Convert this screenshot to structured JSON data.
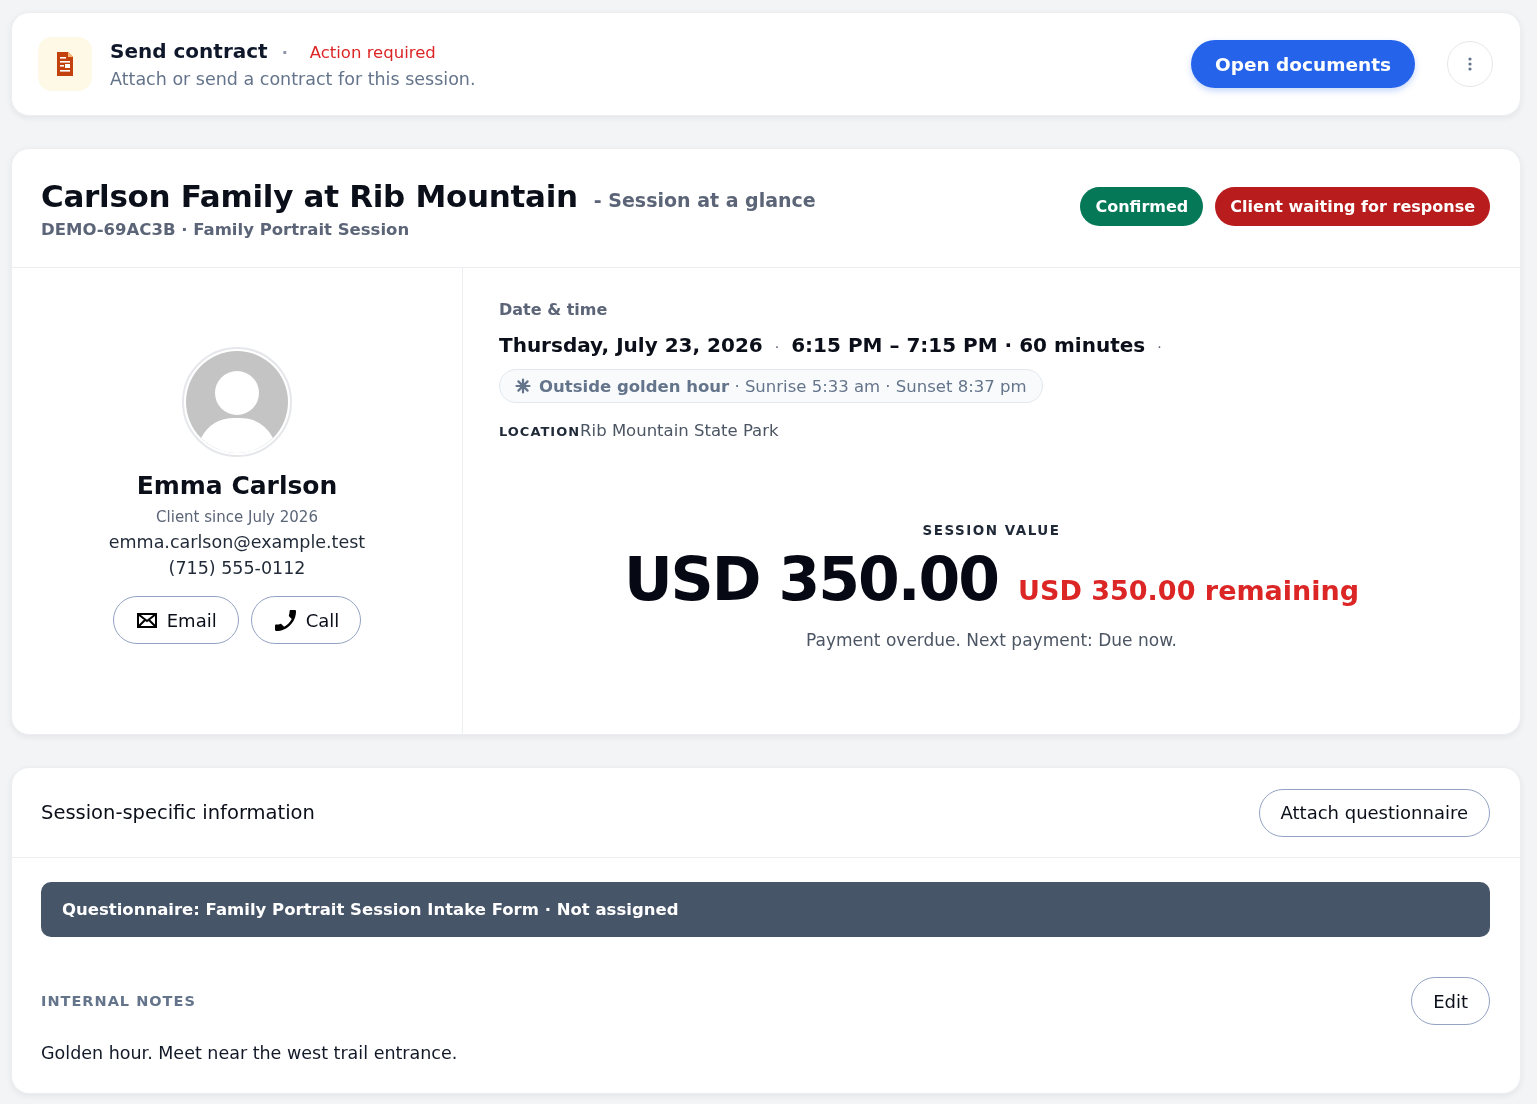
{
  "alert": {
    "title": "Send contract",
    "separator": "·",
    "status": "Action required",
    "description": "Attach or send a contract for this session.",
    "primary_button": "Open documents"
  },
  "session": {
    "title": "Carlson Family at Rib Mountain",
    "subtitle": "- Session at a glance",
    "reference": "DEMO-69AC3B · Family Portrait Session",
    "badges": [
      {
        "label": "Confirmed",
        "color": "#047857"
      },
      {
        "label": "Client waiting for response",
        "color": "#b91c1c"
      }
    ]
  },
  "client": {
    "name": "Emma Carlson",
    "since": "Client since July 2026",
    "email": "emma.carlson@example.test",
    "phone": "(715) 555-0112",
    "actions": [
      {
        "kind": "email",
        "label": "Email"
      },
      {
        "kind": "call",
        "label": "Call"
      }
    ]
  },
  "date_time": {
    "label": "Date & time",
    "segments": [
      {
        "kind": "text",
        "text": "Thursday, July 23, 2026"
      },
      {
        "kind": "separator",
        "text": "·"
      },
      {
        "kind": "text",
        "text": "6:15 PM – 7:15 PM · 60 minutes"
      },
      {
        "kind": "separator",
        "text": "·"
      }
    ],
    "golden_hour": "**Outside golden hour** · Sunrise 5:33 am · Sunset 8:37 pm"
  },
  "location": {
    "label": "LOCATION",
    "value": "Rib Mountain State Park"
  },
  "session_value": {
    "label": "SESSION VALUE",
    "amount": "USD 350.00",
    "remaining": "USD 350.00 remaining",
    "note": "Payment overdue. Next payment: Due now."
  },
  "session_info": {
    "title": "Session-specific information",
    "button": "Attach questionnaire",
    "questionnaire": "Questionnaire: Family Portrait Session Intake Form · Not assigned",
    "notes_label": "INTERNAL NOTES",
    "edit_button": "Edit",
    "notes": "Golden hour. Meet near the west trail entrance."
  }
}
